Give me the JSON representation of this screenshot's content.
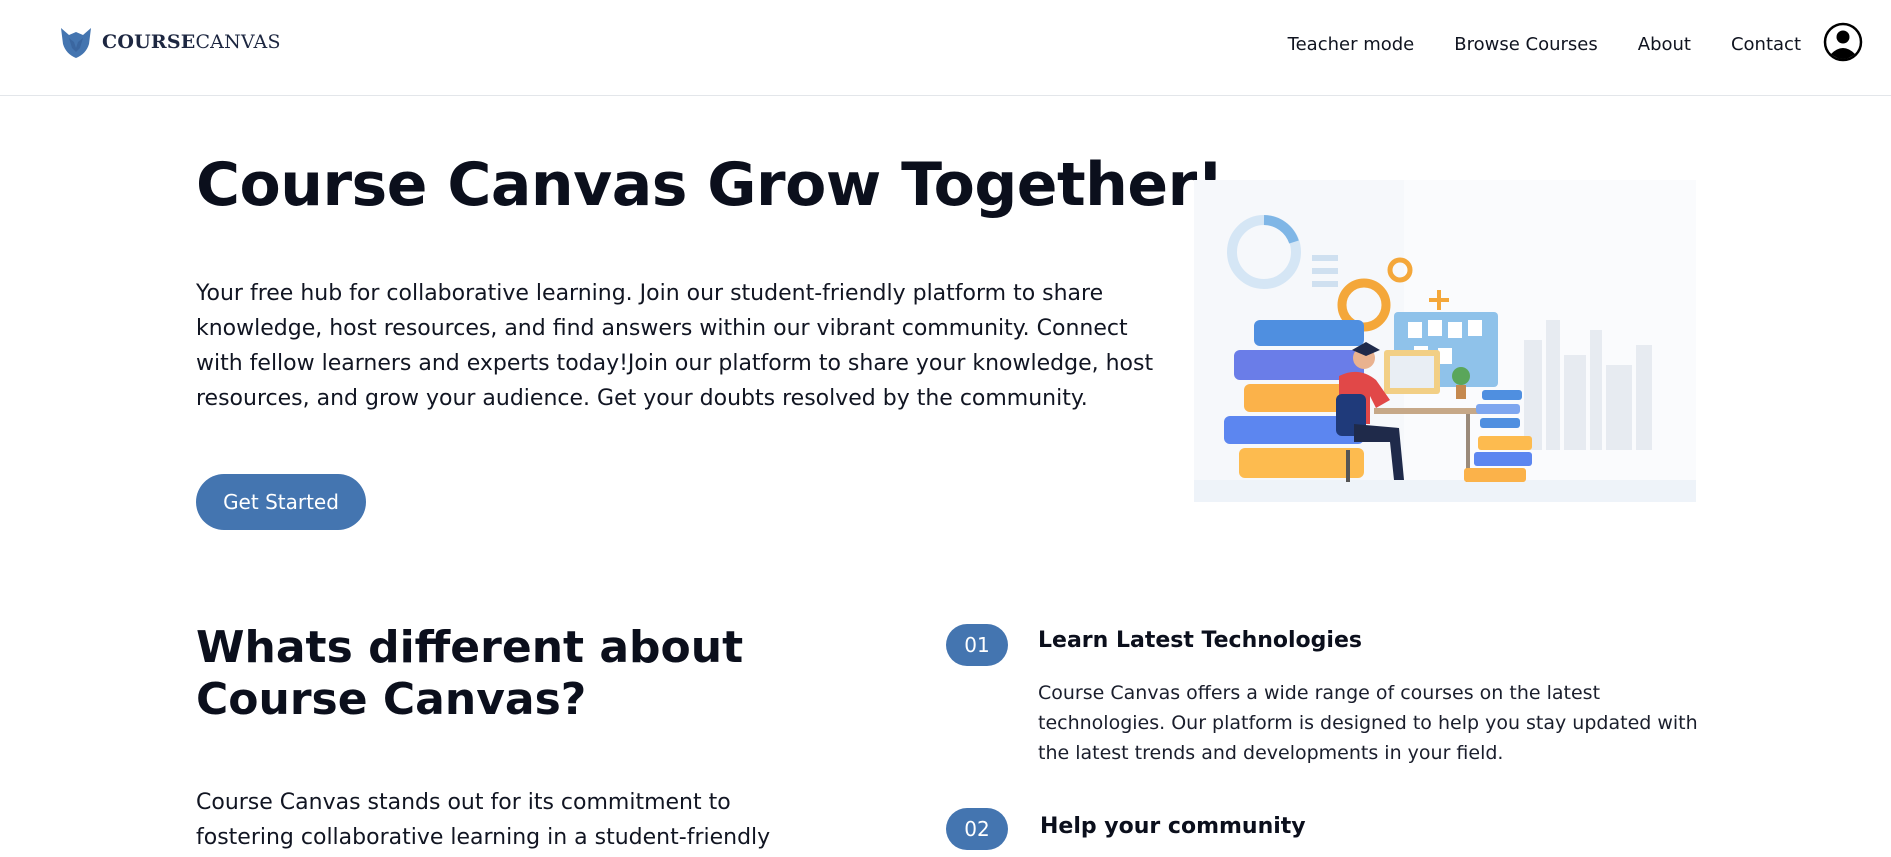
{
  "brand": {
    "name_bold": "COURSE",
    "name_regular": "CANVAS",
    "logo_icon": "fox-shield-logo",
    "color": "#4475b0"
  },
  "nav": {
    "items": [
      {
        "label": "Teacher mode"
      },
      {
        "label": "Browse Courses"
      },
      {
        "label": "About"
      },
      {
        "label": "Contact"
      }
    ],
    "profile_icon": "user-circle-icon"
  },
  "hero": {
    "title": "Course Canvas Grow Together!",
    "description": "Your free hub for collaborative learning. Join our student-friendly platform to share knowledge, host resources, and find answers within our vibrant community. Connect with fellow learners and experts today!Join our platform to share your knowledge, host resources, and grow your audience. Get your doubts resolved by the community.",
    "cta_label": "Get Started",
    "illustration": "student-studying-illustration"
  },
  "features": {
    "title": "Whats different about Course Canvas?",
    "description": "Course Canvas stands out for its commitment to fostering collaborative learning in a student-friendly",
    "items": [
      {
        "number": "01",
        "title": "Learn Latest Technologies",
        "description": "Course Canvas offers a wide range of courses on the latest technologies. Our platform is designed to help you stay updated with the latest trends and developments in your field."
      },
      {
        "number": "02",
        "title": "Help your community",
        "description": ""
      }
    ]
  }
}
